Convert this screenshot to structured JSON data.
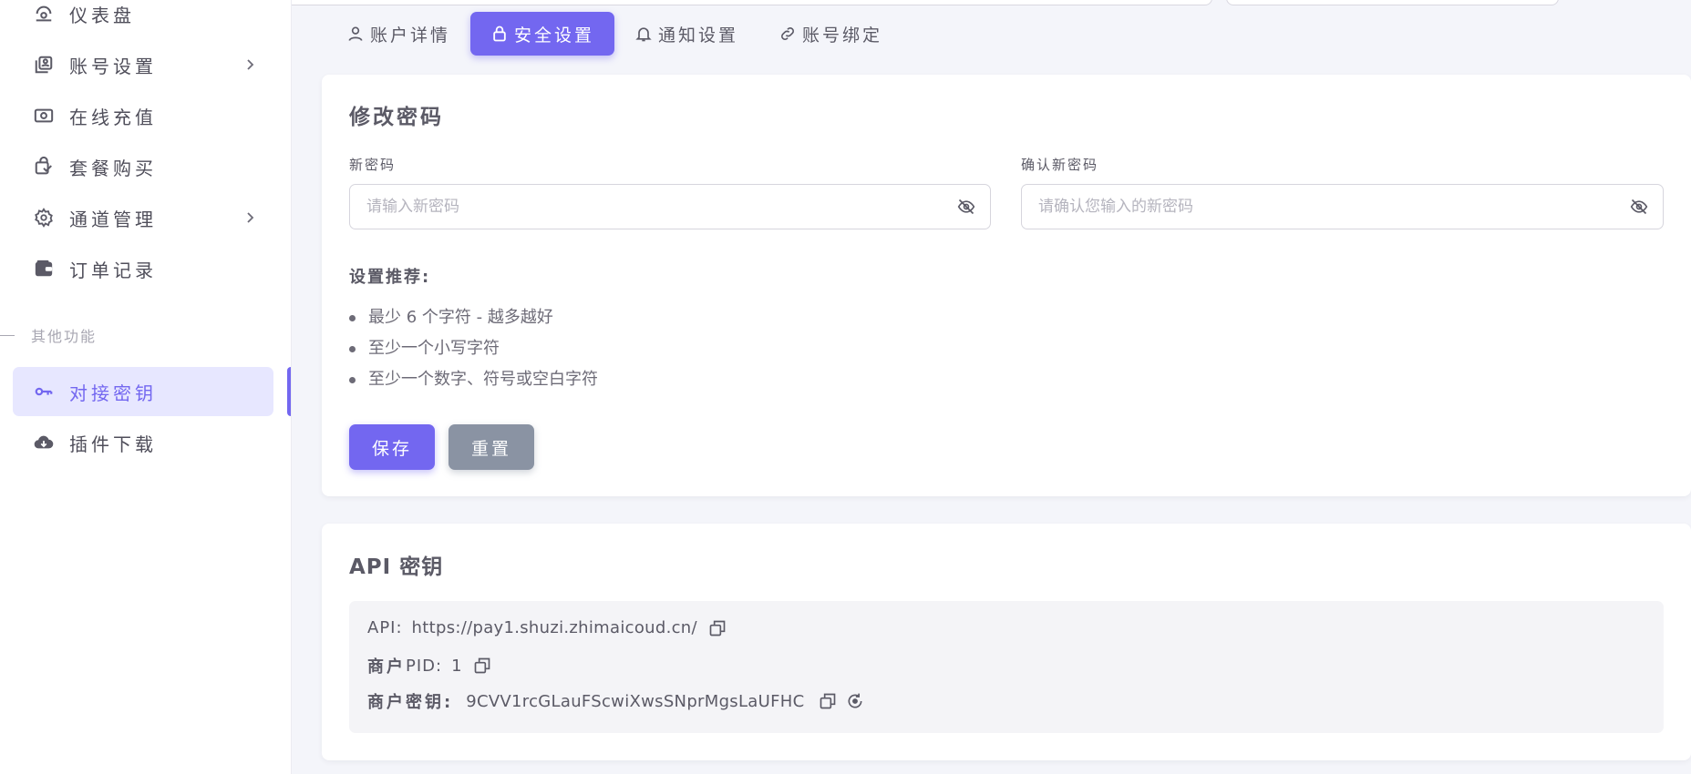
{
  "sidebar": {
    "items": [
      {
        "label": "仪表盘",
        "icon": "dashboard-icon"
      },
      {
        "label": "账号设置",
        "icon": "account-box-icon",
        "has_children": true
      },
      {
        "label": "在线充值",
        "icon": "money-icon"
      },
      {
        "label": "套餐购买",
        "icon": "shopping-bag-icon"
      },
      {
        "label": "通道管理",
        "icon": "gear-icon",
        "has_children": true
      },
      {
        "label": "订单记录",
        "icon": "wallet-icon"
      }
    ],
    "section_label": "其他功能",
    "extra_items": [
      {
        "label": "对接密钥",
        "icon": "key-icon",
        "active": true
      },
      {
        "label": "插件下载",
        "icon": "cloud-download-icon"
      }
    ]
  },
  "tabs": [
    {
      "label": "账户详情",
      "icon": "user-icon"
    },
    {
      "label": "安全设置",
      "icon": "lock-icon",
      "active": true
    },
    {
      "label": "通知设置",
      "icon": "bell-icon"
    },
    {
      "label": "账号绑定",
      "icon": "link-icon"
    }
  ],
  "password_card": {
    "title": "修改密码",
    "new_password_label": "新密码",
    "new_password_placeholder": "请输入新密码",
    "confirm_password_label": "确认新密码",
    "confirm_password_placeholder": "请确认您输入的新密码",
    "recommend_title": "设置推荐:",
    "recommendations": [
      "最少 6 个字符 - 越多越好",
      "至少一个小写字符",
      "至少一个数字、符号或空白字符"
    ],
    "save_label": "保存",
    "reset_label": "重置"
  },
  "api_card": {
    "title": "API 密钥",
    "api_key_label": "API:",
    "api_url": "https://pay1.shuzi.zhimaicoud.cn/",
    "pid_label_bold": "商户",
    "pid_label_rest": "PID:",
    "pid_value": "1",
    "secret_label": "商户密钥:",
    "secret_value": "9CVV1rcGLauFScwiXwsSNprMgsLaUFHC"
  },
  "colors": {
    "primary": "#7367f0",
    "secondary": "#8a93a3",
    "background": "#f4f5fa"
  }
}
